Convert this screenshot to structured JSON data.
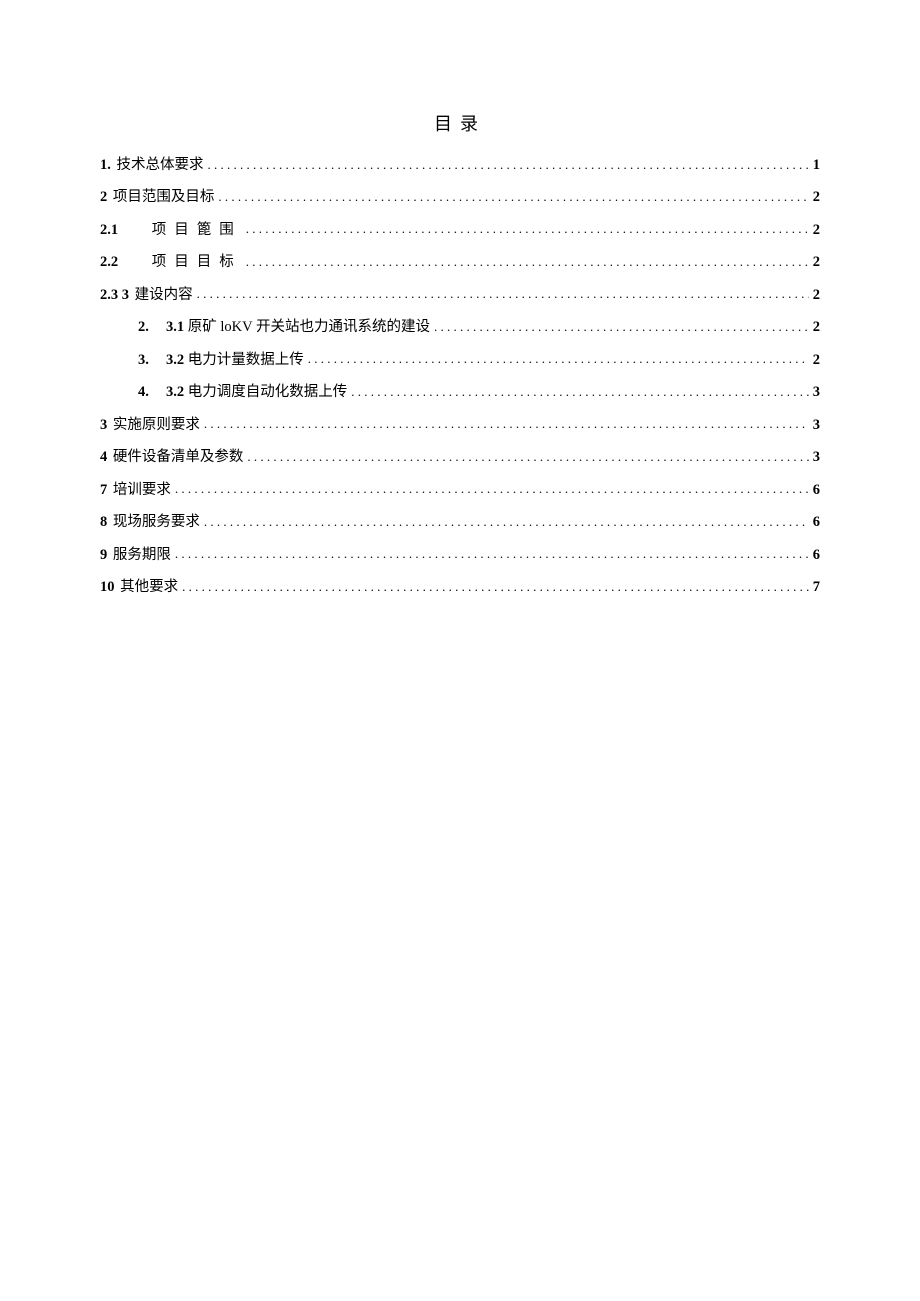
{
  "title": "目录",
  "entries": [
    {
      "num": "1.",
      "text": "技术总体要求",
      "page": "1",
      "indent": 0,
      "numClass": "num",
      "textClass": "text"
    },
    {
      "num": "2",
      "text": "项目范围及目标",
      "page": "2",
      "indent": 0,
      "numClass": "num",
      "textClass": "text"
    },
    {
      "num": "2.1",
      "text": "项目篦围",
      "page": "2",
      "indent": 0,
      "numClass": "num-spaced",
      "textClass": "text-spaced"
    },
    {
      "num": "2.2",
      "text": "项目目标",
      "page": "2",
      "indent": 0,
      "numClass": "num-spaced",
      "textClass": "text-spaced"
    },
    {
      "num": "2.3  3",
      "text": "建设内容",
      "page": "2",
      "indent": 0,
      "numClass": "num",
      "textClass": "text"
    },
    {
      "marker": "2.",
      "subnum": "3.1",
      "subtext": "原矿 loKV 开关站也力通讯系统的建设",
      "page": "2",
      "indent": 1
    },
    {
      "marker": "3.",
      "subnum": "3.2",
      "subtext": "电力计量数据上传",
      "page": "2",
      "indent": 1
    },
    {
      "marker": "4.",
      "subnum": "3.2",
      "subtext": "电力调度自动化数据上传",
      "page": "3",
      "indent": 1
    },
    {
      "num": "3",
      "text": "实施原则要求",
      "page": "3",
      "indent": 0,
      "numClass": "num",
      "textClass": "text"
    },
    {
      "num": "4",
      "text": "硬件设备清单及参数",
      "page": "3",
      "indent": 0,
      "numClass": "num",
      "textClass": "text"
    },
    {
      "num": "7",
      "text": "培训要求",
      "page": "6",
      "indent": 0,
      "numClass": "num",
      "textClass": "text"
    },
    {
      "num": "8",
      "text": "现场服务要求",
      "page": "6",
      "indent": 0,
      "numClass": "num",
      "textClass": "text"
    },
    {
      "num": "9",
      "text": "服务期限",
      "page": "6",
      "indent": 0,
      "numClass": "num",
      "textClass": "text"
    },
    {
      "num": "10",
      "text": "其他要求",
      "page": "7",
      "indent": 0,
      "numClass": "num",
      "textClass": "text"
    }
  ]
}
